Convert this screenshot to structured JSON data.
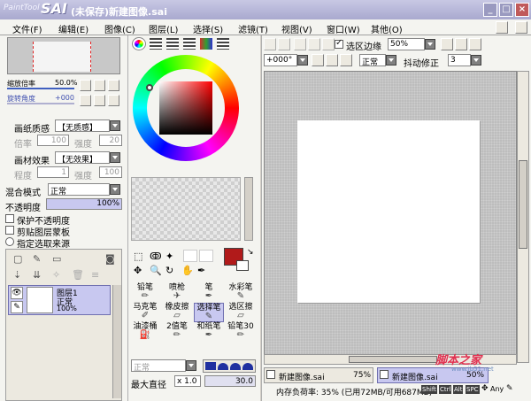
{
  "app": {
    "logo_small": "PaintTool",
    "logo_big": "SAI",
    "title": "(未保存)新建图像.sai",
    "win_buttons": [
      "_",
      "□",
      "×"
    ]
  },
  "menu": [
    "文件(F)",
    "编辑(E)",
    "图像(C)",
    "图层(L)",
    "选择(S)",
    "滤镜(T)",
    "视图(V)",
    "窗口(W)",
    "其他(O)"
  ],
  "navigator": {
    "zoom_label": "缩放倍率",
    "zoom_value": "50.0%",
    "angle_label": "旋转角度",
    "angle_value": "+000"
  },
  "texture": {
    "paper_label": "画纸质感",
    "paper_value": "【无质感】",
    "scale_label": "倍率",
    "scale_value": "100",
    "strength_label": "强度",
    "strength_value": "20"
  },
  "effect": {
    "effect_label": "画材效果",
    "effect_value": "【无效果】",
    "degree_label": "程度",
    "degree_value": "1",
    "strength_label": "强度",
    "strength_value": "100"
  },
  "blend": {
    "mode_label": "混合模式",
    "mode_value": "正常",
    "opacity_label": "不透明度",
    "opacity_value": "100%"
  },
  "checks": [
    "保护不透明度",
    "剪贴图层蒙板",
    "指定选取来源"
  ],
  "layer": {
    "name": "图层1",
    "mode": "正常",
    "opacity": "100%"
  },
  "colors": {
    "primary": "#b11a1a",
    "accent": "#c8c8f0"
  },
  "tools": [
    {
      "label": "铅笔",
      "icon": "pencil"
    },
    {
      "label": "喷枪",
      "icon": "airbrush"
    },
    {
      "label": "笔",
      "icon": "pen"
    },
    {
      "label": "水彩笔",
      "icon": "watercolor"
    },
    {
      "label": "马克笔",
      "icon": "marker"
    },
    {
      "label": "橡皮擦",
      "icon": "eraser"
    },
    {
      "label": "选择笔",
      "icon": "select-pen"
    },
    {
      "label": "选区擦",
      "icon": "select-eraser"
    },
    {
      "label": "油漆桶",
      "icon": "bucket"
    },
    {
      "label": "2值笔",
      "icon": "binary-pen"
    },
    {
      "label": "和纸笔",
      "icon": "washi-pen"
    },
    {
      "label": "铅笔30",
      "icon": "pencil30"
    }
  ],
  "brush": {
    "mode_value": "正常",
    "size_label": "最大直径",
    "size_mult": "x 1.0",
    "size_value": "30.0"
  },
  "canvas_toolbar": {
    "edge_label": "选区边缘",
    "zoom_value": "50%",
    "angle_value": "+000°",
    "mode_value": "正常",
    "stab_label": "抖动修正",
    "stab_value": "3"
  },
  "tabs": [
    {
      "name": "新建图像.sai",
      "zoom": "75%"
    },
    {
      "name": "新建图像.sai",
      "zoom": "50%"
    }
  ],
  "status": {
    "memory": "内存负荷率: 35% (已用72MB/可用687MB)",
    "keys": [
      "Shift",
      "Ctrl",
      "Alt",
      "SPC"
    ],
    "any": "Any"
  },
  "watermark": {
    "text": "脚本之家",
    "url": "www.jb51.net"
  }
}
